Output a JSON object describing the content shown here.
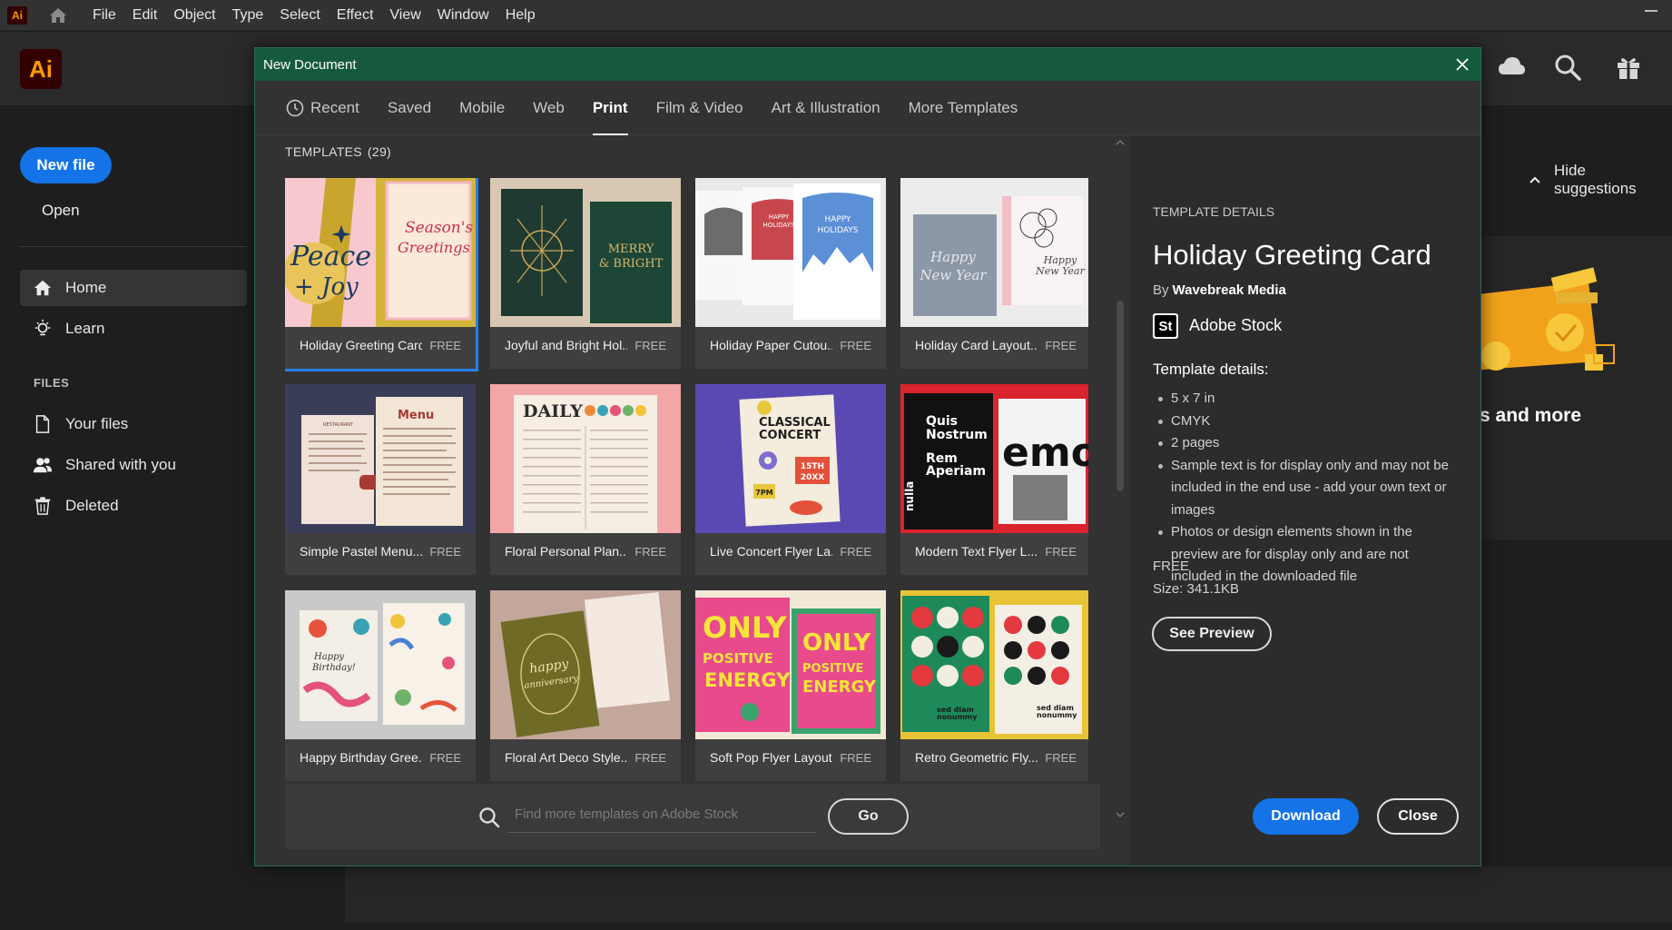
{
  "app": {
    "mini_logo": "Ai",
    "logo": "Ai"
  },
  "menu": [
    "File",
    "Edit",
    "Object",
    "Type",
    "Select",
    "Effect",
    "View",
    "Window",
    "Help"
  ],
  "header_icons": [
    "cloud-icon",
    "search-icon",
    "gift-icon"
  ],
  "sidebar": {
    "new_file": "New file",
    "open": "Open",
    "nav": [
      {
        "label": "Home",
        "icon": "home-icon",
        "active": true
      },
      {
        "label": "Learn",
        "icon": "lightbulb-icon",
        "active": false
      }
    ],
    "files_heading": "FILES",
    "files": [
      {
        "label": "Your files",
        "icon": "file-icon"
      },
      {
        "label": "Shared with you",
        "icon": "shared-users-icon"
      },
      {
        "label": "Deleted",
        "icon": "trash-icon"
      }
    ]
  },
  "background": {
    "hide_suggestions": "Hide suggestions",
    "suggestion_text": "s and more"
  },
  "dialog": {
    "title": "New Document",
    "tabs": [
      {
        "label": "Recent",
        "active": false
      },
      {
        "label": "Saved",
        "active": false
      },
      {
        "label": "Mobile",
        "active": false
      },
      {
        "label": "Web",
        "active": false
      },
      {
        "label": "Print",
        "active": true
      },
      {
        "label": "Film & Video",
        "active": false
      },
      {
        "label": "Art & Illustration",
        "active": false
      },
      {
        "label": "More Templates",
        "active": false
      }
    ],
    "templates_heading": "TEMPLATES",
    "templates_count": "(29)",
    "templates": [
      {
        "label": "Holiday Greeting Card",
        "price": "FREE",
        "selected": true
      },
      {
        "label": "Joyful and Bright Hol...",
        "price": "FREE"
      },
      {
        "label": "Holiday Paper Cutou...",
        "price": "FREE"
      },
      {
        "label": "Holiday Card Layout...",
        "price": "FREE"
      },
      {
        "label": "Simple Pastel Menu...",
        "price": "FREE"
      },
      {
        "label": "Floral Personal Plan...",
        "price": "FREE"
      },
      {
        "label": "Live Concert Flyer La...",
        "price": "FREE"
      },
      {
        "label": "Modern Text Flyer L...",
        "price": "FREE"
      },
      {
        "label": "Happy Birthday Gree...",
        "price": "FREE"
      },
      {
        "label": "Floral Art Deco Style...",
        "price": "FREE"
      },
      {
        "label": "Soft Pop Flyer Layout",
        "price": "FREE"
      },
      {
        "label": "Retro Geometric Fly...",
        "price": "FREE"
      }
    ],
    "search": {
      "placeholder": "Find more templates on Adobe Stock",
      "go": "Go"
    },
    "details": {
      "heading": "TEMPLATE DETAILS",
      "title": "Holiday Greeting Card",
      "by": "By",
      "author": "Wavebreak Media",
      "source_badge": "St",
      "source": "Adobe Stock",
      "sub_heading": "Template details:",
      "items": [
        "5 x 7 in",
        "CMYK",
        "2 pages",
        "Sample text is for display only and may not be included in the end use - add your own text or images",
        "Photos or design elements shown in the preview are for display only and are not included in the downloaded file"
      ],
      "price": "FREE",
      "size": "Size:  341.1KB",
      "see_preview": "See Preview"
    },
    "download": "Download",
    "close": "Close"
  },
  "thumb_text": {
    "t1_peace": "Peace",
    "t1_joy": "+ Joy",
    "t1_seasons": "Season's",
    "t1_greetings": "Greetings",
    "t2_merry": "MERRY",
    "t2_bright": "& BRIGHT",
    "t3_happy": "HAPPY",
    "t3_holidays": "HOLIDAYS",
    "t4_happy": "Happy",
    "t4_newyear": "New Year",
    "t5_menu": "Menu",
    "t5_restaurant": "RESTAURANT",
    "t6_daily": "DAILY",
    "t7_classical": "CLASSICAL",
    "t7_concert": "CONCERT",
    "t7_date": "15TH",
    "t7_year": "20XX",
    "t7_time": "7PM",
    "t8_quis": "Quis",
    "t8_nostrum": "Nostrum",
    "t8_rem": "Rem",
    "t8_aperiam": "Aperiam",
    "t8_nulla": "nulla",
    "t8_emo": "emo",
    "t9_happy": "Happy",
    "t9_birthday": "Birthday!",
    "t10_happy": "happy",
    "t10_anniversary": "anniversary",
    "t11_only": "ONLY",
    "t11_positive": "POSITIVE",
    "t11_energy": "ENERGY",
    "t12_sed": "sed diam",
    "t12_nonummy": "nonummy"
  }
}
